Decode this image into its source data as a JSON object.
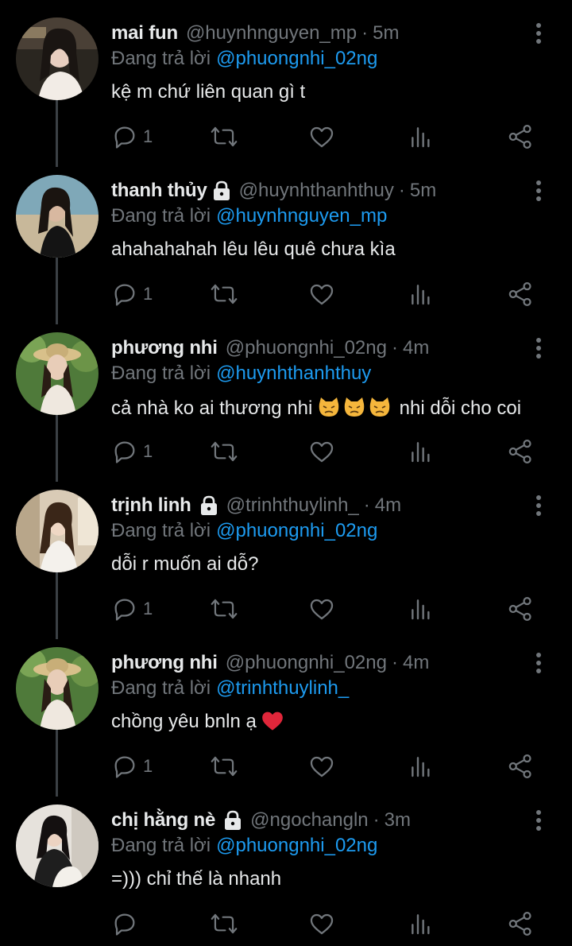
{
  "reply_prefix": "Đang trả lời",
  "tweets": [
    {
      "name": "mai fun",
      "locked": false,
      "handle": "@huynhnguyen_mp",
      "dot": "·",
      "time": "5m",
      "reply_to": "@phuongnhi_02ng",
      "text": "kệ m chứ liên quan gì t",
      "reply_count": "1"
    },
    {
      "name": "thanh thủy",
      "locked": true,
      "handle": "@huynhthanhthuy",
      "dot": "·",
      "time": "5m",
      "reply_to": "@huynhnguyen_mp",
      "text": "ahahahahah lêu lêu quê chưa kìa",
      "reply_count": "1"
    },
    {
      "name": "phương nhi",
      "locked": false,
      "handle": "@phuongnhi_02ng",
      "dot": "·",
      "time": "4m",
      "reply_to": "@huynhthanhthuy",
      "text": "cả nhà ko ai thương nhi",
      "emoji": "angry-cat-face x3",
      "text_after": "nhi dỗi cho coi",
      "reply_count": "1"
    },
    {
      "name": "trịnh linh",
      "locked": true,
      "handle": "@trinhthuylinh_",
      "dot": "·",
      "time": "4m",
      "reply_to": "@phuongnhi_02ng",
      "text": "dỗi r muốn ai dỗ?",
      "reply_count": "1"
    },
    {
      "name": "phương nhi",
      "locked": false,
      "handle": "@phuongnhi_02ng",
      "dot": "·",
      "time": "4m",
      "reply_to": "@trinhthuylinh_",
      "text": "chồng yêu bnln ạ",
      "emoji": "red-heart",
      "reply_count": "1"
    },
    {
      "name": "chị hằng nè",
      "locked": true,
      "handle": "@ngochangln",
      "dot": "·",
      "time": "3m",
      "reply_to": "@phuongnhi_02ng",
      "text": "=))) chỉ thế là nhanh",
      "reply_count": ""
    }
  ],
  "colors": {
    "background": "#000000",
    "text": "#e7e9ea",
    "muted": "#71767b",
    "link": "#1d9bf0",
    "thread_line": "#3b4045"
  },
  "icons": [
    "reply-icon",
    "retweet-icon",
    "like-icon",
    "views-icon",
    "share-icon",
    "more-icon",
    "lock-icon"
  ]
}
